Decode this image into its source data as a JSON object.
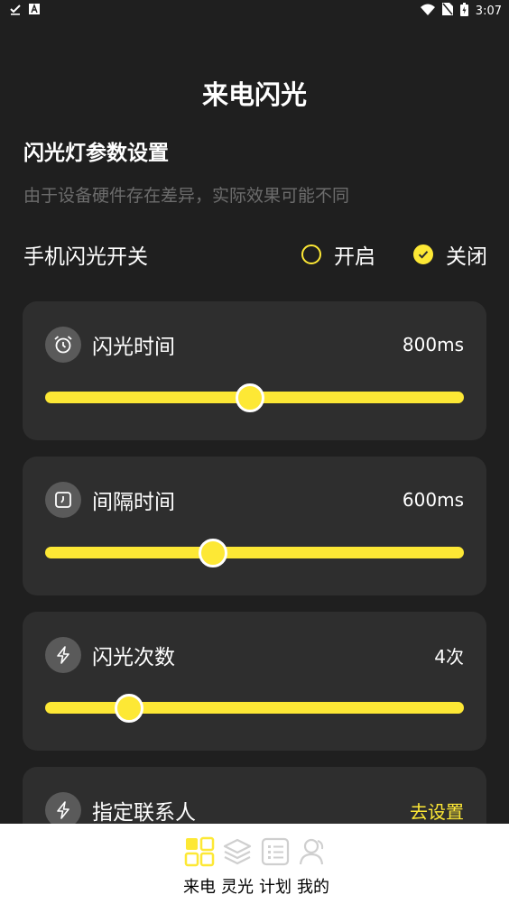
{
  "status_bar": {
    "time": "3:07"
  },
  "header": {
    "title": "来电闪光"
  },
  "settings": {
    "title": "闪光灯参数设置",
    "subtitle": "由于设备硬件存在差异，实际效果可能不同"
  },
  "flash_switch": {
    "label": "手机闪光开关",
    "options": [
      {
        "label": "开启",
        "selected": false
      },
      {
        "label": "关闭",
        "selected": true
      }
    ]
  },
  "cards": {
    "flash_time": {
      "title": "闪光时间",
      "value": "800ms",
      "slider_fraction": 0.49
    },
    "interval_time": {
      "title": "间隔时间",
      "value": "600ms",
      "slider_fraction": 0.4
    },
    "flash_count": {
      "title": "闪光次数",
      "value": "4次",
      "slider_fraction": 0.2
    },
    "contact": {
      "title": "指定联系人",
      "action": "去设置"
    }
  },
  "bottom_nav": {
    "items": [
      {
        "label": "来电",
        "icon": "grid-icon"
      },
      {
        "label": "灵光",
        "icon": "layers-icon"
      },
      {
        "label": "计划",
        "icon": "list-icon"
      },
      {
        "label": "我的",
        "icon": "user-icon"
      }
    ]
  },
  "colors": {
    "accent": "#fde835",
    "background": "#1f1f1f",
    "card": "#2e2e2e"
  }
}
